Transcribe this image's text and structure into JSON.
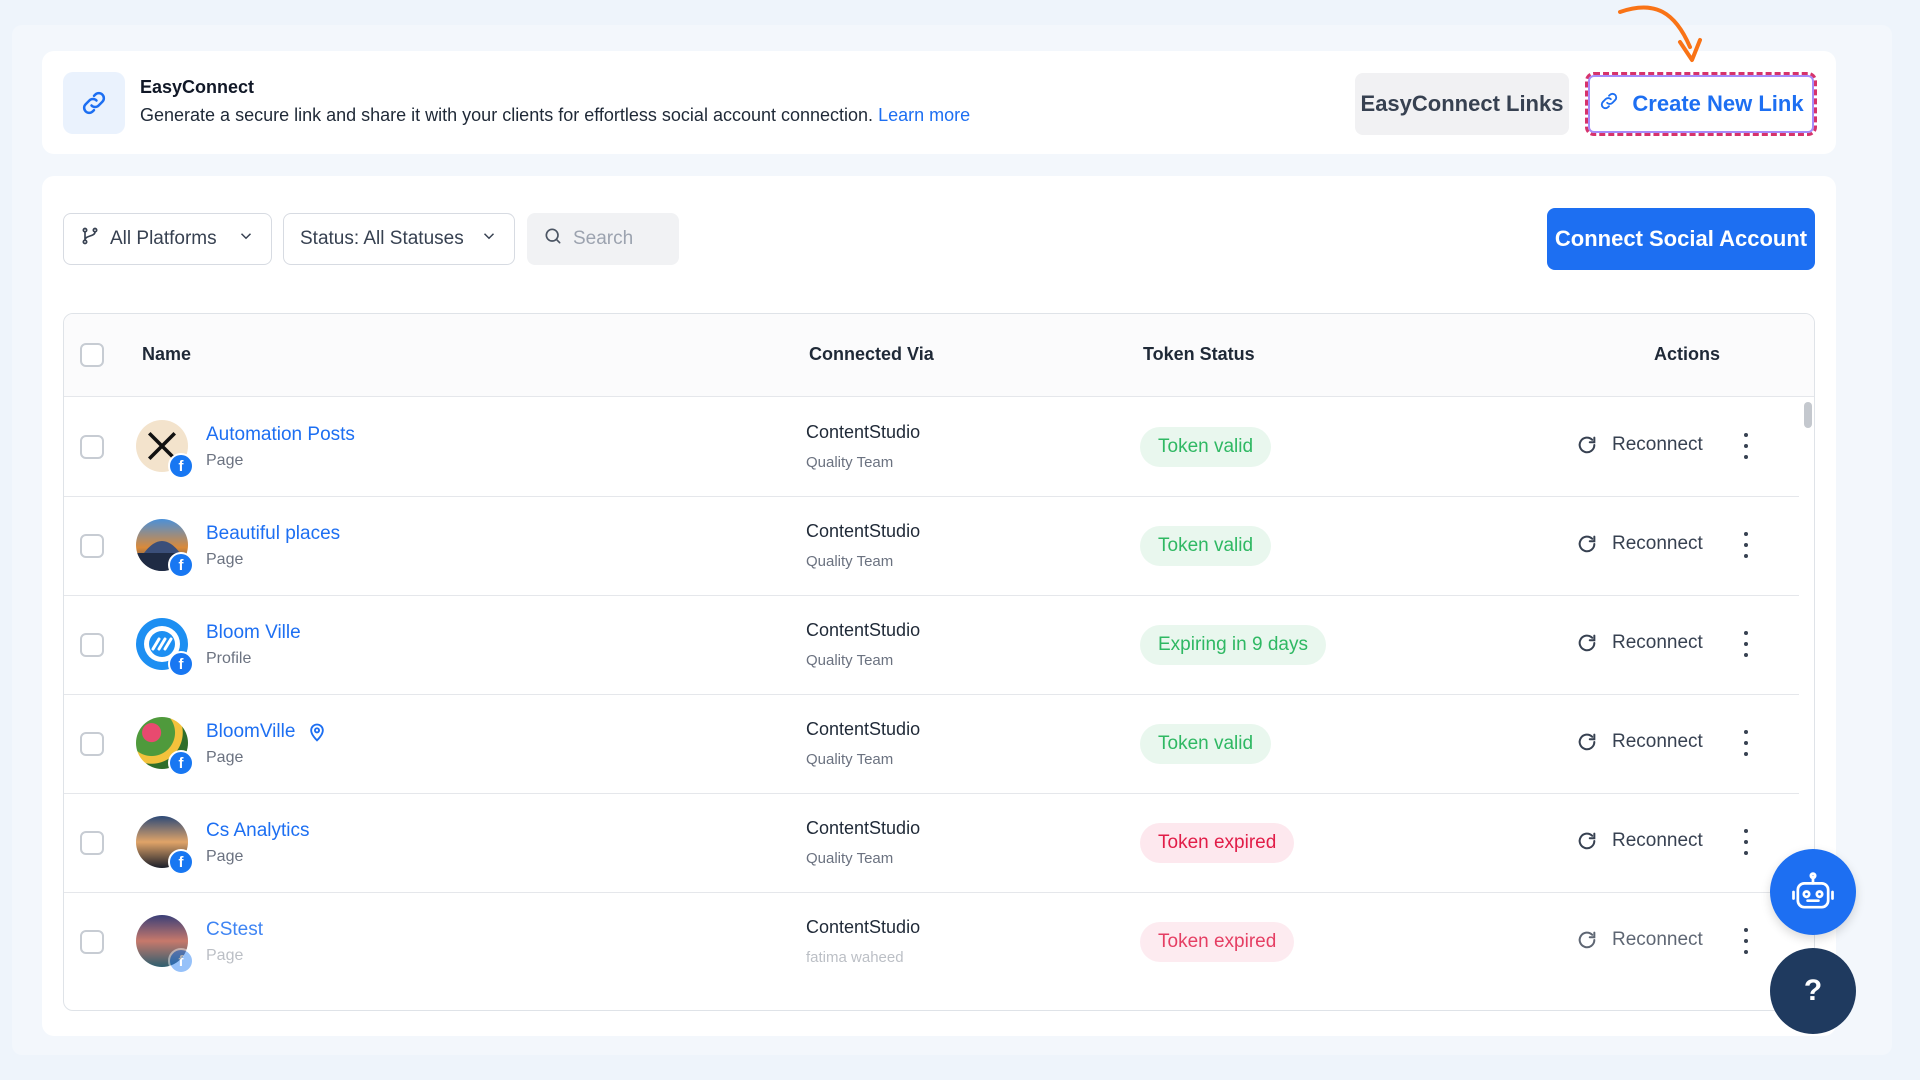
{
  "easyconnect": {
    "title": "EasyConnect",
    "description": "Generate a secure link and share it with your clients for effortless social account connection.",
    "learn_more": "Learn more",
    "links_button": "EasyConnect Links",
    "create_button": "Create New Link"
  },
  "filters": {
    "platforms": "All Platforms",
    "status": "Status: All Statuses",
    "search_placeholder": "Search"
  },
  "connect_button": "Connect Social Account",
  "table": {
    "headers": {
      "name": "Name",
      "connected_via": "Connected Via",
      "token_status": "Token Status",
      "actions": "Actions"
    },
    "rows": [
      {
        "name": "Automation Posts",
        "type": "Page",
        "via": "ContentStudio",
        "team": "Quality Team",
        "status": "Token valid",
        "status_kind": "valid",
        "action": "Reconnect",
        "avatar": "x-logo"
      },
      {
        "name": "Beautiful places",
        "type": "Page",
        "via": "ContentStudio",
        "team": "Quality Team",
        "status": "Token valid",
        "status_kind": "valid",
        "action": "Reconnect",
        "avatar": "landscape-dome"
      },
      {
        "name": "Bloom Ville",
        "type": "Profile",
        "via": "ContentStudio",
        "team": "Quality Team",
        "status": "Expiring in 9 days",
        "status_kind": "valid",
        "action": "Reconnect",
        "avatar": "blue-logo"
      },
      {
        "name": "BloomVille",
        "type": "Page",
        "via": "ContentStudio",
        "team": "Quality Team",
        "status": "Token valid",
        "status_kind": "valid",
        "action": "Reconnect",
        "avatar": "flowers",
        "location_icon": true
      },
      {
        "name": "Cs Analytics",
        "type": "Page",
        "via": "ContentStudio",
        "team": "Quality Team",
        "status": "Token expired",
        "status_kind": "expired",
        "action": "Reconnect",
        "avatar": "car-sunset"
      },
      {
        "name": "CStest",
        "type": "Page",
        "via": "ContentStudio",
        "team": "fatima waheed",
        "status": "Token expired",
        "status_kind": "expired",
        "action": "Reconnect",
        "avatar": "lake-sunset"
      }
    ]
  },
  "colors": {
    "accent": "#1d6ff2",
    "valid": "#2fb863",
    "expired": "#e11d48",
    "help_bg": "#1f3a5f"
  }
}
